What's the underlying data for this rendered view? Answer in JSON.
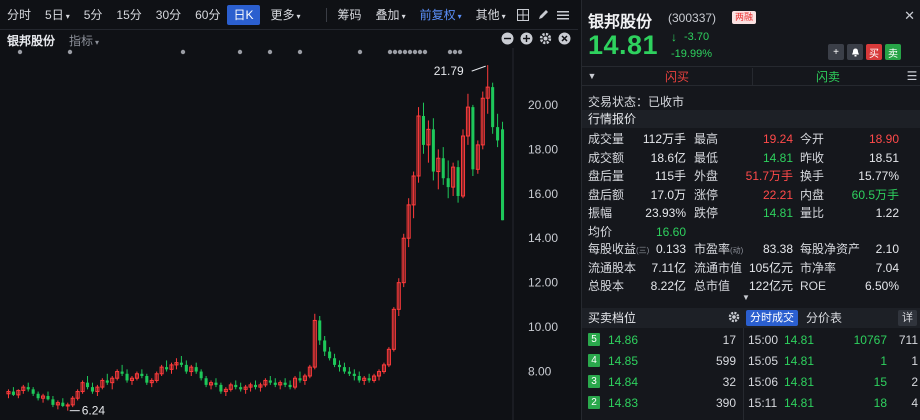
{
  "toolbar": {
    "periods": [
      "分时",
      "5日",
      "5分",
      "15分",
      "30分",
      "60分",
      "日K",
      "更多"
    ],
    "active_period": "日K",
    "chip": "筹码",
    "overlay": "叠加",
    "adjust": "前复权",
    "other": "其他"
  },
  "subbar": {
    "stock": "银邦股份",
    "indicator": "指标"
  },
  "chart_data": {
    "type": "candlestick",
    "title": "",
    "y_ticks": [
      "20.00",
      "18.00",
      "16.00",
      "14.00",
      "12.00",
      "10.00",
      "8.00"
    ],
    "ylim": [
      6.0,
      22.2
    ],
    "annotations": {
      "high_label": "21.79",
      "low_label": "6.24"
    },
    "up_color": "#ff3b3b",
    "down_color": "#1ec85a",
    "candles": [
      [
        7.0,
        7.2,
        6.8,
        7.1
      ],
      [
        7.1,
        7.3,
        6.9,
        6.95
      ],
      [
        6.95,
        7.2,
        6.8,
        7.15
      ],
      [
        7.15,
        7.4,
        7.0,
        7.3
      ],
      [
        7.3,
        7.5,
        7.1,
        7.2
      ],
      [
        7.2,
        7.3,
        6.9,
        7.0
      ],
      [
        7.0,
        7.1,
        6.7,
        6.8
      ],
      [
        6.8,
        7.0,
        6.6,
        6.9
      ],
      [
        6.9,
        7.1,
        6.7,
        6.75
      ],
      [
        6.75,
        6.9,
        6.4,
        6.5
      ],
      [
        6.5,
        6.7,
        6.3,
        6.6
      ],
      [
        6.6,
        6.8,
        6.4,
        6.45
      ],
      [
        6.45,
        6.6,
        6.24,
        6.5
      ],
      [
        6.5,
        6.9,
        6.4,
        6.8
      ],
      [
        6.8,
        7.2,
        6.7,
        7.1
      ],
      [
        7.1,
        7.6,
        7.0,
        7.5
      ],
      [
        7.5,
        7.8,
        7.2,
        7.3
      ],
      [
        7.3,
        7.5,
        7.0,
        7.1
      ],
      [
        7.1,
        7.4,
        6.9,
        7.3
      ],
      [
        7.3,
        7.7,
        7.2,
        7.6
      ],
      [
        7.6,
        7.9,
        7.4,
        7.5
      ],
      [
        7.5,
        7.8,
        7.2,
        7.7
      ],
      [
        7.7,
        8.1,
        7.6,
        8.0
      ],
      [
        8.0,
        8.3,
        7.8,
        7.9
      ],
      [
        7.9,
        8.1,
        7.5,
        7.6
      ],
      [
        7.6,
        7.8,
        7.4,
        7.7
      ],
      [
        7.7,
        8.0,
        7.6,
        7.9
      ],
      [
        7.9,
        8.1,
        7.7,
        7.8
      ],
      [
        7.8,
        7.9,
        7.4,
        7.5
      ],
      [
        7.5,
        7.7,
        7.3,
        7.6
      ],
      [
        7.6,
        8.0,
        7.5,
        7.9
      ],
      [
        7.9,
        8.3,
        7.8,
        8.2
      ],
      [
        8.2,
        8.5,
        8.0,
        8.1
      ],
      [
        8.1,
        8.4,
        7.9,
        8.3
      ],
      [
        8.3,
        8.6,
        8.1,
        8.4
      ],
      [
        8.4,
        8.7,
        8.2,
        8.3
      ],
      [
        8.3,
        8.5,
        7.9,
        8.0
      ],
      [
        8.0,
        8.3,
        7.8,
        8.2
      ],
      [
        8.2,
        8.4,
        7.9,
        8.0
      ],
      [
        8.0,
        8.1,
        7.6,
        7.7
      ],
      [
        7.7,
        7.8,
        7.3,
        7.4
      ],
      [
        7.4,
        7.6,
        7.2,
        7.5
      ],
      [
        7.5,
        7.7,
        7.3,
        7.4
      ],
      [
        7.4,
        7.5,
        7.0,
        7.1
      ],
      [
        7.1,
        7.3,
        6.9,
        7.2
      ],
      [
        7.2,
        7.5,
        7.1,
        7.4
      ],
      [
        7.4,
        7.6,
        7.2,
        7.3
      ],
      [
        7.3,
        7.5,
        7.1,
        7.2
      ],
      [
        7.2,
        7.4,
        7.0,
        7.3
      ],
      [
        7.3,
        7.5,
        7.1,
        7.4
      ],
      [
        7.4,
        7.6,
        7.2,
        7.3
      ],
      [
        7.3,
        7.5,
        7.1,
        7.4
      ],
      [
        7.4,
        7.7,
        7.3,
        7.6
      ],
      [
        7.6,
        7.8,
        7.4,
        7.5
      ],
      [
        7.5,
        7.7,
        7.3,
        7.4
      ],
      [
        7.4,
        7.6,
        7.2,
        7.5
      ],
      [
        7.5,
        7.7,
        7.3,
        7.4
      ],
      [
        7.4,
        7.6,
        7.2,
        7.3
      ],
      [
        7.3,
        7.8,
        7.2,
        7.7
      ],
      [
        7.7,
        8.0,
        7.5,
        7.6
      ],
      [
        7.6,
        7.9,
        7.4,
        7.8
      ],
      [
        7.8,
        8.3,
        7.7,
        8.2
      ],
      [
        8.2,
        10.6,
        8.1,
        10.3
      ],
      [
        10.3,
        10.5,
        9.2,
        9.4
      ],
      [
        9.4,
        9.6,
        8.7,
        8.9
      ],
      [
        8.9,
        9.1,
        8.5,
        8.6
      ],
      [
        8.6,
        8.8,
        8.2,
        8.3
      ],
      [
        8.3,
        8.5,
        8.0,
        8.2
      ],
      [
        8.2,
        8.4,
        7.9,
        8.0
      ],
      [
        8.0,
        8.2,
        7.8,
        7.9
      ],
      [
        7.9,
        8.1,
        7.6,
        7.8
      ],
      [
        7.8,
        8.0,
        7.5,
        7.6
      ],
      [
        7.6,
        7.8,
        7.4,
        7.7
      ],
      [
        7.7,
        7.9,
        7.5,
        7.6
      ],
      [
        7.6,
        7.9,
        7.5,
        7.8
      ],
      [
        7.8,
        8.1,
        7.6,
        8.0
      ],
      [
        8.0,
        8.4,
        7.9,
        8.3
      ],
      [
        8.3,
        9.1,
        8.2,
        9.0
      ],
      [
        9.0,
        10.9,
        8.9,
        10.8
      ],
      [
        10.8,
        12.2,
        10.5,
        12.0
      ],
      [
        12.0,
        14.2,
        11.8,
        14.0
      ],
      [
        14.0,
        15.8,
        13.6,
        15.5
      ],
      [
        15.5,
        17.0,
        14.9,
        16.8
      ],
      [
        16.8,
        19.9,
        16.5,
        19.5
      ],
      [
        19.5,
        20.1,
        17.8,
        18.2
      ],
      [
        18.2,
        19.3,
        17.4,
        18.9
      ],
      [
        18.9,
        19.4,
        16.6,
        17.0
      ],
      [
        17.0,
        18.0,
        16.2,
        17.6
      ],
      [
        17.6,
        18.1,
        16.4,
        16.7
      ],
      [
        16.7,
        17.5,
        15.8,
        16.3
      ],
      [
        16.3,
        17.4,
        15.9,
        17.2
      ],
      [
        17.2,
        17.5,
        15.6,
        15.9
      ],
      [
        15.9,
        18.9,
        15.8,
        18.6
      ],
      [
        18.6,
        20.5,
        18.2,
        19.9
      ],
      [
        19.9,
        20.0,
        16.8,
        17.1
      ],
      [
        17.1,
        18.4,
        16.9,
        18.2
      ],
      [
        18.2,
        20.6,
        18.0,
        20.3
      ],
      [
        20.3,
        21.79,
        19.6,
        20.8
      ],
      [
        20.8,
        21.0,
        18.7,
        19.0
      ],
      [
        19.0,
        19.6,
        18.1,
        18.4
      ],
      [
        18.9,
        19.24,
        14.81,
        14.81
      ]
    ]
  },
  "quote": {
    "name": "银邦股份",
    "code": "(300337)",
    "badge": "两融",
    "price": "14.81",
    "arrow": "↓",
    "change": "-3.70",
    "change_pct": "-19.99%",
    "trade_status": "交易状态：已收市",
    "section_title": "行情报价",
    "flash_buy": "闪买",
    "flash_sell": "闪卖",
    "rows": [
      [
        [
          "成交量",
          "112万手",
          "flat"
        ],
        [
          "最高",
          "19.24",
          "up"
        ],
        [
          "今开",
          "18.90",
          "up"
        ]
      ],
      [
        [
          "成交额",
          "18.6亿",
          "flat"
        ],
        [
          "最低",
          "14.81",
          "down"
        ],
        [
          "昨收",
          "18.51",
          "flat"
        ]
      ],
      [
        [
          "盘后量",
          "115手",
          "flat"
        ],
        [
          "外盘",
          "51.7万手",
          "up"
        ],
        [
          "换手",
          "15.77%",
          "flat"
        ]
      ],
      [
        [
          "盘后额",
          "17.0万",
          "flat"
        ],
        [
          "涨停",
          "22.21",
          "up"
        ],
        [
          "内盘",
          "60.5万手",
          "down"
        ]
      ],
      [
        [
          "振幅",
          "23.93%",
          "flat"
        ],
        [
          "跌停",
          "14.81",
          "down"
        ],
        [
          "量比",
          "1.22",
          "flat"
        ]
      ],
      [
        [
          "均价",
          "16.60",
          "down"
        ]
      ]
    ],
    "rows2": [
      [
        [
          "每股收益",
          "0.133",
          "flat",
          "(三)"
        ],
        [
          "市盈率",
          "83.38",
          "flat",
          "(动)"
        ],
        [
          "每股净资产",
          "2.10",
          "flat",
          ""
        ]
      ],
      [
        [
          "流通股本",
          "7.11亿",
          "flat",
          ""
        ],
        [
          "流通市值",
          "105亿元",
          "flat",
          ""
        ],
        [
          "市净率",
          "7.04",
          "flat",
          ""
        ]
      ],
      [
        [
          "总股本",
          "8.22亿",
          "flat",
          ""
        ],
        [
          "总市值",
          "122亿元",
          "flat",
          ""
        ],
        [
          "ROE",
          "6.50%",
          "flat",
          ""
        ]
      ]
    ]
  },
  "bottom": {
    "tab_orderbook": "买卖档位",
    "tab_ticks": "分时成交",
    "tab_price": "分价表",
    "tab_detail": "详",
    "orderbook": [
      {
        "level": "5",
        "price": "14.86",
        "vol": "17"
      },
      {
        "level": "4",
        "price": "14.85",
        "vol": "599"
      },
      {
        "level": "3",
        "price": "14.84",
        "vol": "32"
      },
      {
        "level": "2",
        "price": "14.83",
        "vol": "390"
      }
    ],
    "ticks": [
      {
        "time": "15:00",
        "price": "14.81",
        "vol": "10767",
        "num": "711"
      },
      {
        "time": "15:05",
        "price": "14.81",
        "vol": "1",
        "num": "1"
      },
      {
        "time": "15:06",
        "price": "14.81",
        "vol": "15",
        "num": "2"
      },
      {
        "time": "15:11",
        "price": "14.81",
        "vol": "18",
        "num": "4"
      }
    ]
  }
}
